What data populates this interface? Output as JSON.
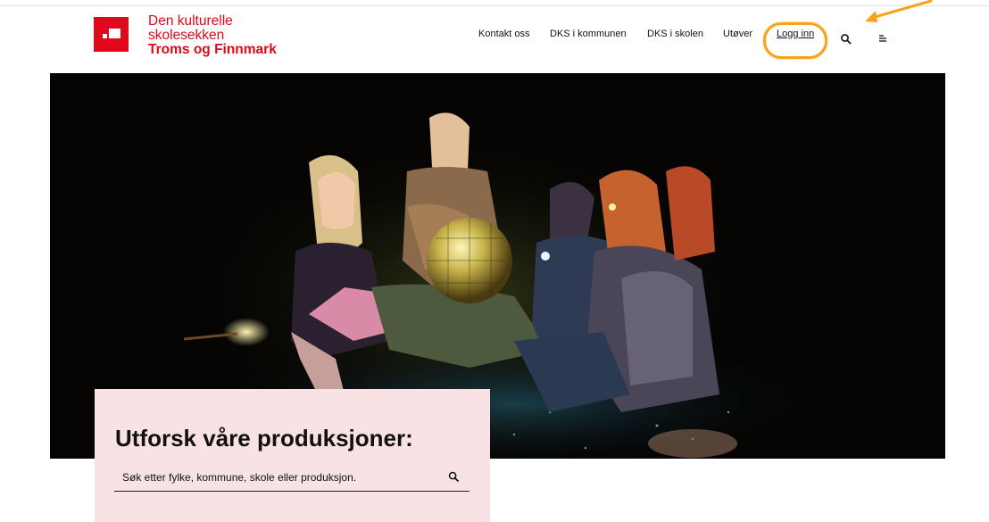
{
  "brand": {
    "line1": "Den kulturelle",
    "line2": "skolesekken",
    "line3": "Troms og Finnmark",
    "color": "#e1081c"
  },
  "nav": {
    "items": [
      "Kontakt oss",
      "DKS i kommunen",
      "DKS i skolen",
      "Utøver"
    ],
    "login_label": "Logg inn",
    "search_icon": "search-icon",
    "menu_icon": "menu-icon"
  },
  "annotation": {
    "highlight_color": "#f7a21b",
    "arrow_icon": "arrow-icon"
  },
  "hero": {
    "image": "hero-photo-children-with-disco-ball"
  },
  "search": {
    "heading": "Utforsk våre produksjoner:",
    "placeholder": "Søk etter fylke, kommune, skole eller produksjon.",
    "value": "",
    "panel_color": "#f8e2e4"
  }
}
